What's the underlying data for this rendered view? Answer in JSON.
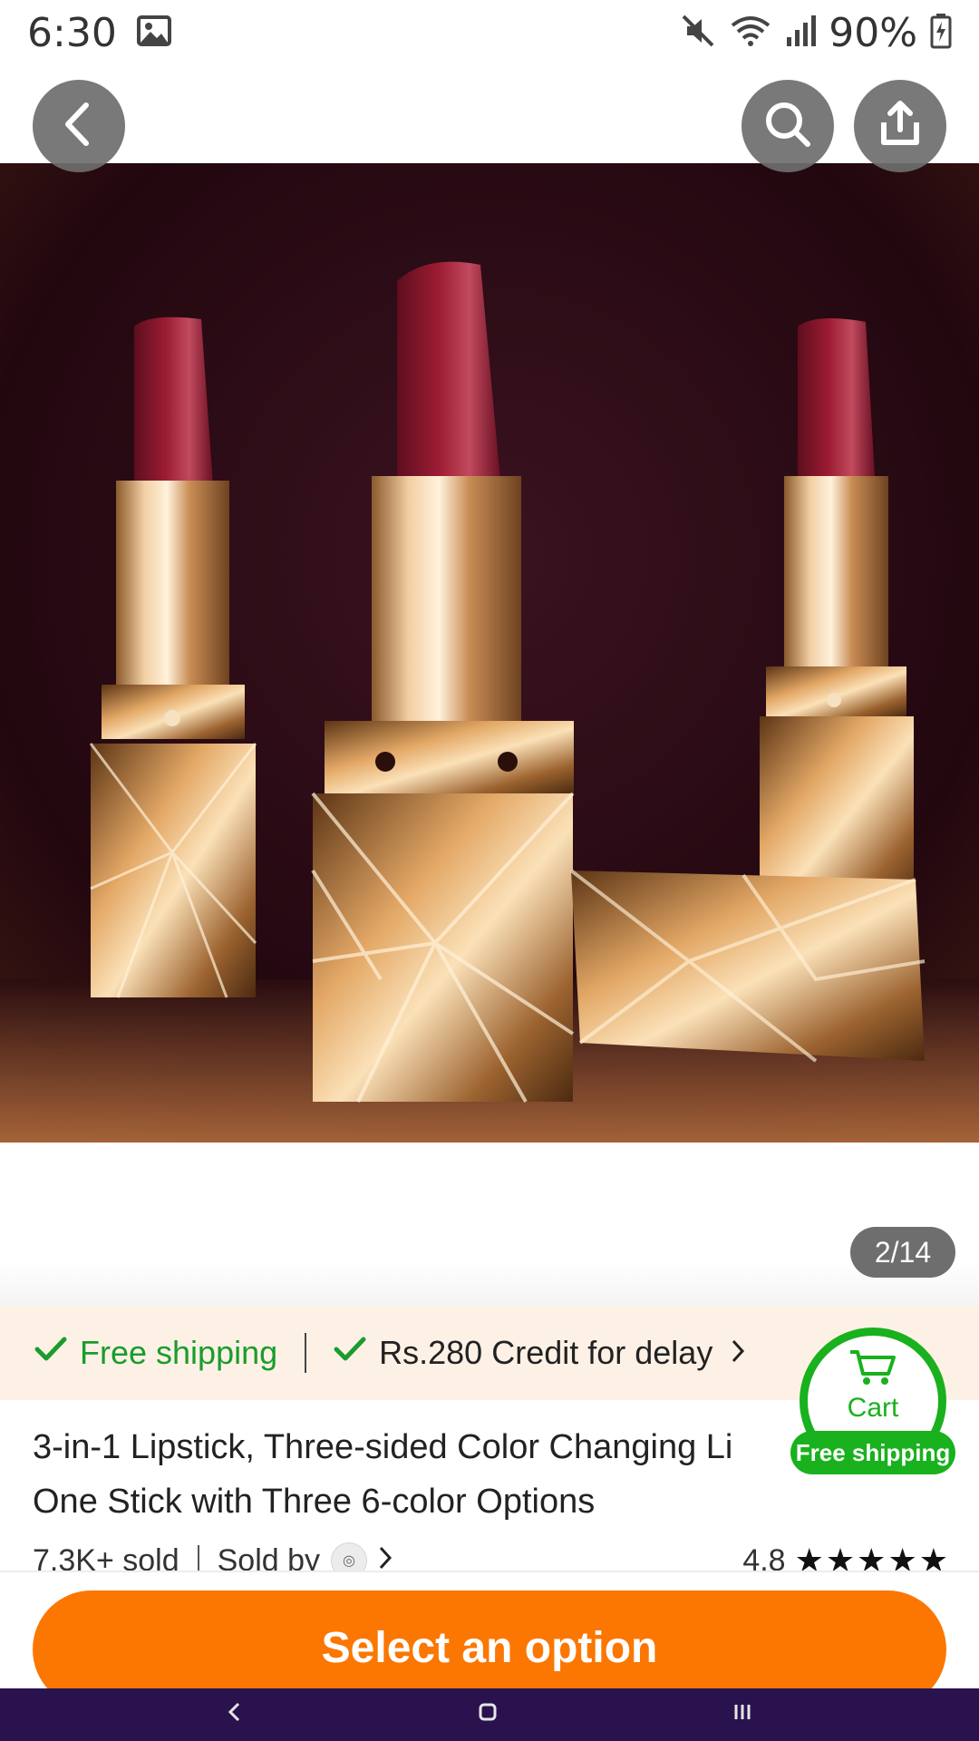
{
  "status_bar": {
    "time": "6:30",
    "battery": "90%",
    "icons": [
      "image-icon",
      "mute-icon",
      "wifi-icon",
      "signal-icon",
      "battery-charging-icon"
    ]
  },
  "top_nav": {
    "icons": [
      "back-arrow-icon",
      "search-icon",
      "share-icon"
    ]
  },
  "gallery": {
    "counter": "2/14"
  },
  "shipping": {
    "free_label": "Free shipping",
    "credit_label": "Rs.280 Credit for delay"
  },
  "cart_badge": {
    "label": "Cart",
    "ship_label": "Free shipping"
  },
  "product": {
    "title_line1": "3-in-1 Lipstick, Three-sided Color Changing Li",
    "title_line2": "One Stick with Three 6-color Options",
    "sold": "7.3K+ sold",
    "sold_by": "Sold by",
    "rating": "4.8",
    "stars": 5
  },
  "actions": {
    "select_label": "Select an option"
  },
  "colors": {
    "accent": "#fb7701",
    "green": "#19b11d",
    "nav_bg": "#2a124f"
  }
}
